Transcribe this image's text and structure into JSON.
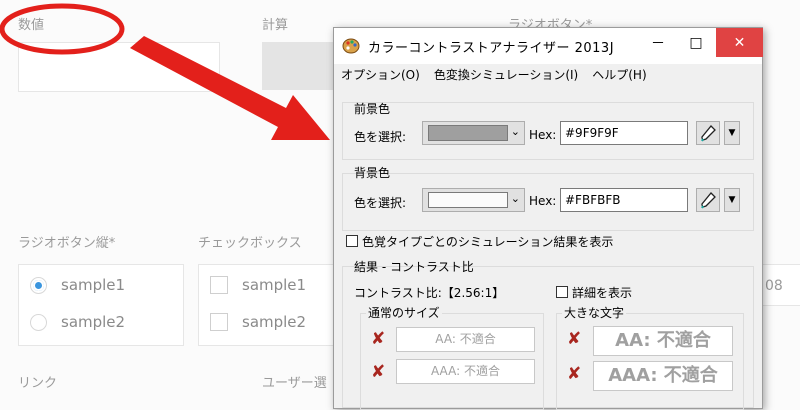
{
  "form": {
    "label_number": "数値",
    "label_calc": "計算",
    "label_radio": "ラジオボタン*",
    "label_radio_vertical": "ラジオボタン縦*",
    "label_checkbox": "チェックボックス",
    "radio_items": [
      "sample1",
      "sample2"
    ],
    "checkbox_items": [
      "sample1",
      "sample2"
    ],
    "label_link": "リンク",
    "label_user": "ユーザー選",
    "partial_number": "08"
  },
  "dialog": {
    "title": "カラーコントラストアナライザー 2013J",
    "titlebar_buttons": {
      "minimize": "－",
      "maximize": "□",
      "close": "✕"
    },
    "menu": [
      "オプション(O)",
      "色変換シミュレーション(I)",
      "ヘルプ(H)"
    ],
    "foreground": {
      "group_title": "前景色",
      "select_label": "色を選択:",
      "hex_label": "Hex:",
      "hex_value": "#9F9F9F",
      "color": "#9f9f9f"
    },
    "background": {
      "group_title": "背景色",
      "select_label": "色を選択:",
      "hex_label": "Hex:",
      "hex_value": "#FBFBFB",
      "color": "#fbfbfb"
    },
    "show_simulation_label": "色覚タイプごとのシミュレーション結果を表示",
    "result": {
      "group_title": "結果 - コントラスト比",
      "ratio_label": "コントラスト比:【2.56:1】",
      "details_label": "詳細を表示",
      "normal_title": "通常のサイズ",
      "large_title": "大きな文字",
      "normal_aa": "AA: 不適合",
      "normal_aaa": "AAA: 不適合",
      "large_aa": "AA: 不適合",
      "large_aaa": "AAA: 不適合"
    }
  },
  "annotation": {
    "arrow_color": "#e3201b",
    "circle_color": "#e3201b"
  }
}
